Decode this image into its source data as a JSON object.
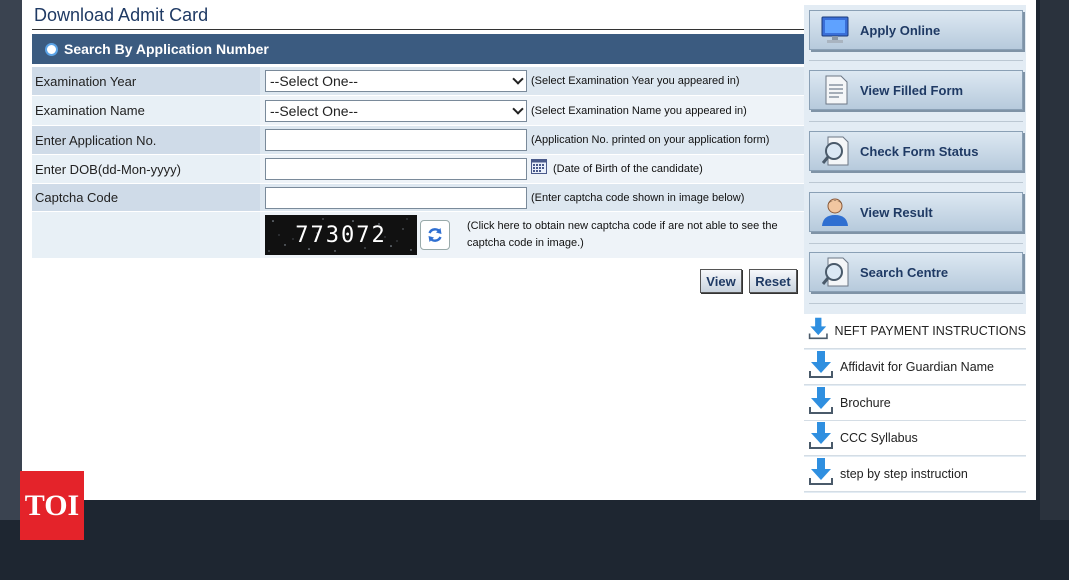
{
  "page": {
    "title": "Download Admit Card",
    "search_mode_label": "Search By Application Number"
  },
  "form": {
    "rows": [
      {
        "label": "Examination Year",
        "control": "select",
        "value": "--Select One--",
        "hint": "(Select Examination Year you appeared in)"
      },
      {
        "label": "Examination Name",
        "control": "select",
        "value": "--Select One--",
        "hint": "(Select Examination Name you appeared in)"
      },
      {
        "label": "Enter Application No.",
        "control": "text",
        "value": "",
        "hint": "(Application No. printed on your application form)"
      },
      {
        "label": "Enter DOB(dd-Mon-yyyy)",
        "control": "date",
        "value": "",
        "hint": "(Date of Birth of the candidate)"
      },
      {
        "label": "Captcha Code",
        "control": "text",
        "value": "",
        "hint": "(Enter captcha code shown in image below)"
      }
    ],
    "captcha": {
      "code": "773072",
      "hint": "(Click here to obtain new captcha code if are not able to see the captcha code in image.)"
    },
    "buttons": {
      "view": "View",
      "reset": "Reset"
    }
  },
  "sidebar": {
    "buttons": [
      {
        "label": "Apply Online",
        "icon": "monitor-icon"
      },
      {
        "label": "View Filled Form",
        "icon": "document-icon"
      },
      {
        "label": "Check Form Status",
        "icon": "magnifier-document-icon"
      },
      {
        "label": "View Result",
        "icon": "user-icon"
      },
      {
        "label": "Search Centre",
        "icon": "magnifier-document-icon"
      }
    ],
    "downloads": [
      {
        "label": "NEFT PAYMENT INSTRUCTIONS"
      },
      {
        "label": "Affidavit for Guardian Name"
      },
      {
        "label": "Brochure"
      },
      {
        "label": "CCC Syllabus"
      },
      {
        "label": "step by step instruction"
      }
    ]
  },
  "watermark": {
    "logo_text": "TOI",
    "color": "#e4232a"
  },
  "colors": {
    "header_bar": "#3b5b80",
    "title_text": "#1f3a64",
    "background": "#1e2631"
  }
}
